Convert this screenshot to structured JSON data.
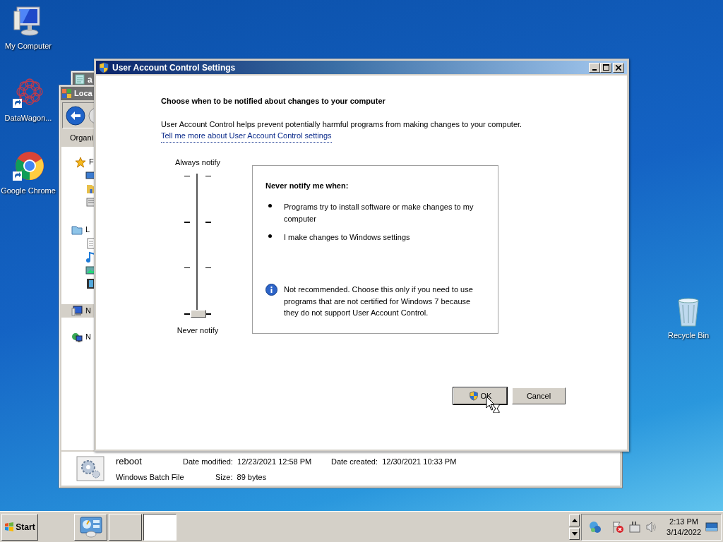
{
  "desktop_icons": [
    {
      "label": "My Computer",
      "kind": "computer"
    },
    {
      "label": "DataWagon...",
      "kind": "mandala"
    },
    {
      "label": "Google Chrome",
      "kind": "browser"
    },
    {
      "label": "Recycle Bin",
      "kind": "bin"
    }
  ],
  "notepad_window": {
    "title": "a"
  },
  "explorer_window": {
    "title": "Loca",
    "toolbar_label": "Organi",
    "nav_items": [
      {
        "label": "F",
        "kind": "favorites",
        "selected": false
      },
      {
        "label": "L",
        "kind": "libraries",
        "selected": false
      },
      {
        "label": "N",
        "kind": "computer",
        "selected": true
      },
      {
        "label": "N",
        "kind": "network",
        "selected": false
      }
    ],
    "details": {
      "name": "reboot",
      "type": "Windows Batch File",
      "properties": [
        {
          "label": "Date modified:",
          "value": "12/23/2021 12:58 PM"
        },
        {
          "label": "Date created:",
          "value": "12/30/2021 10:33 PM"
        },
        {
          "label": "Size:",
          "value": "89 bytes"
        }
      ]
    }
  },
  "uac_dialog": {
    "title": "User Account Control Settings",
    "heading": "Choose when to be notified about changes to your computer",
    "description": "User Account Control helps prevent potentially harmful programs from making changes to your computer.",
    "link": "Tell me more about User Account Control settings",
    "slider": {
      "top_label": "Always notify",
      "bottom_label": "Never notify",
      "level": 0
    },
    "info": {
      "heading": "Never notify me when:",
      "bullets": [
        "Programs try to install software or make changes to my computer",
        "I make changes to Windows settings"
      ],
      "note": "Not recommended. Choose this only if you need to use programs that are not certified for Windows 7 because they do not support User Account Control."
    },
    "buttons": [
      {
        "label": "OK",
        "kind": "shield",
        "focused": true
      },
      {
        "label": "Cancel",
        "kind": "plain",
        "focused": false
      }
    ]
  },
  "taskbar": {
    "start": "Start",
    "tasks": [
      {
        "kind": "app",
        "selected": false
      },
      {
        "kind": "blank",
        "selected": false
      },
      {
        "kind": "blank",
        "selected": true
      }
    ],
    "time": "2:13 PM",
    "date": "3/14/2022"
  }
}
